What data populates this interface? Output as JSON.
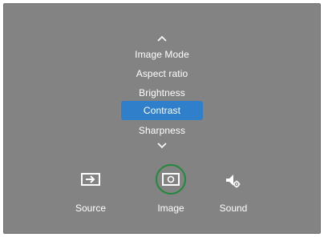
{
  "menu": {
    "up_icon": "chevron-up-icon",
    "down_icon": "chevron-down-icon",
    "items": [
      {
        "label": "Image Mode"
      },
      {
        "label": "Aspect ratio"
      },
      {
        "label": "Brightness"
      },
      {
        "label": "Contrast",
        "selected": true
      },
      {
        "label": "Sharpness"
      }
    ]
  },
  "bottom": [
    {
      "label": "Source",
      "icon": "source-input-icon"
    },
    {
      "label": "Image",
      "icon": "image-icon",
      "focused": true
    },
    {
      "label": "Sound",
      "icon": "sound-settings-icon"
    }
  ],
  "colors": {
    "screen_bg": "#838383",
    "selected_bg": "#2f7fca",
    "focus_ring": "#1e8a3c"
  }
}
